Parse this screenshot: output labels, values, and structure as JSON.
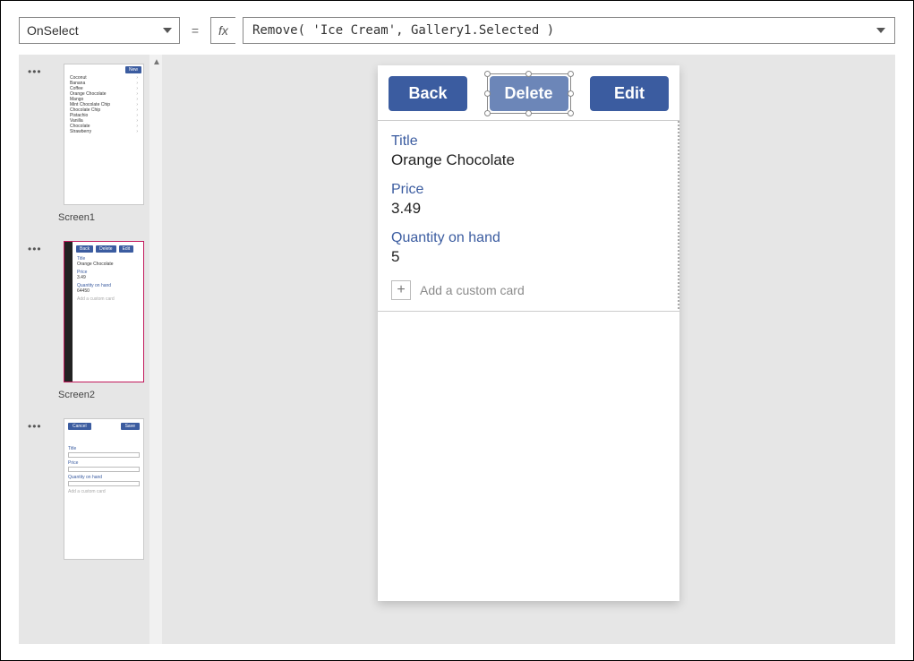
{
  "formula_bar": {
    "property": "OnSelect",
    "equals": "=",
    "fx": "fx",
    "formula": "Remove( 'Ice Cream', Gallery1.Selected )"
  },
  "thumbnails": {
    "screen1": {
      "label": "Screen1",
      "new_button": "New",
      "items": [
        "Coconut",
        "Banana",
        "Coffee",
        "Orange Chocolate",
        "Mango",
        "Mint Chocolate Chip",
        "Chocolate Chip",
        "Pistachio",
        "Vanilla",
        "Chocolate",
        "Strawberry"
      ]
    },
    "screen2": {
      "label": "Screen2",
      "buttons": {
        "back": "Back",
        "delete": "Delete",
        "edit": "Edit"
      },
      "cards": {
        "title_lbl": "Title",
        "title_val": "Orange Chocolate",
        "price_lbl": "Price",
        "price_val": "3.49",
        "qty_lbl": "Quantity on hand",
        "qty_val": "64450",
        "add": "Add a custom card"
      }
    },
    "screen3": {
      "buttons": {
        "cancel": "Cancel",
        "save": "Save"
      },
      "title_lbl": "Title",
      "price_lbl": "Price",
      "qty_lbl": "Quantity on hand",
      "add": "Add a custom card"
    }
  },
  "canvas": {
    "buttons": {
      "back": "Back",
      "delete": "Delete",
      "edit": "Edit"
    },
    "cards": {
      "title_lbl": "Title",
      "title_val": "Orange Chocolate",
      "price_lbl": "Price",
      "price_val": "3.49",
      "qty_lbl": "Quantity on hand",
      "qty_val": "5"
    },
    "add_card": "Add a custom card"
  }
}
